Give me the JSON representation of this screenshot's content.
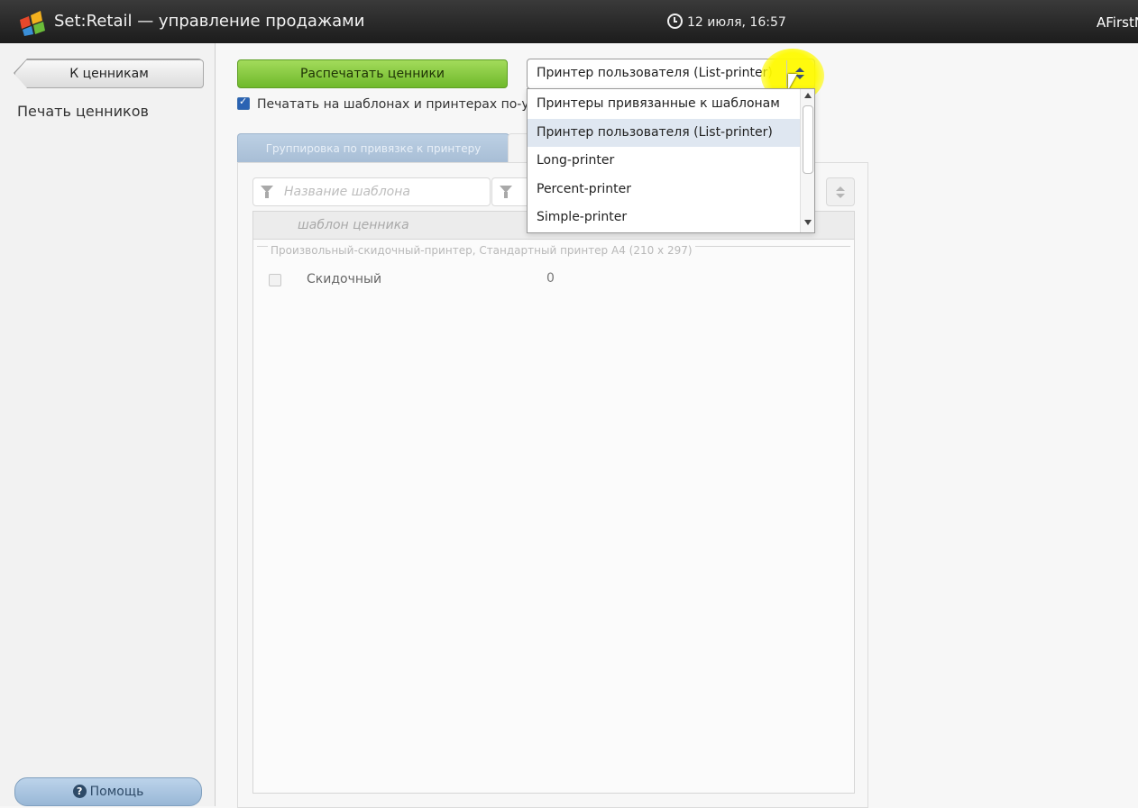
{
  "app": {
    "title": "Set:Retail — управление продажами",
    "clock": "12 июля, 16:57",
    "user": "AFirstN"
  },
  "sidebar": {
    "back_button": "К ценникам",
    "section_title": "Печать ценников",
    "help_button": "Помощь"
  },
  "main": {
    "print_button": "Распечатать ценники",
    "default_checkbox_label": "Печатать на шаблонах и принтерах по-умо",
    "default_checkbox_checked": true,
    "tab_grouping": "Группировка по привязке к принтеру",
    "filters": {
      "template_placeholder": "Название шаблона",
      "second_placeholder": ""
    },
    "table": {
      "column_template": "шаблон ценника",
      "group_label": "Произвольный-скидочный-принтер, Стандартный принтер А4 (210 x 297)",
      "rows": [
        {
          "name": "Скидочный",
          "count": "0",
          "checked": false
        }
      ]
    }
  },
  "printer_select": {
    "selected": "Принтер пользователя (List-printer)",
    "options": [
      "Принтеры привязанные к шаблонам",
      "Принтер пользователя (List-printer)",
      "Long-printer",
      "Percent-printer",
      "Simple-printer"
    ],
    "selected_index": 1
  },
  "colors": {
    "titlebar": "#2a2a2a",
    "print_button": "#8fcf45",
    "help_button": "#aac5e0",
    "selected_option": "#dfe7f1",
    "cursor_highlight": "#fff200"
  }
}
